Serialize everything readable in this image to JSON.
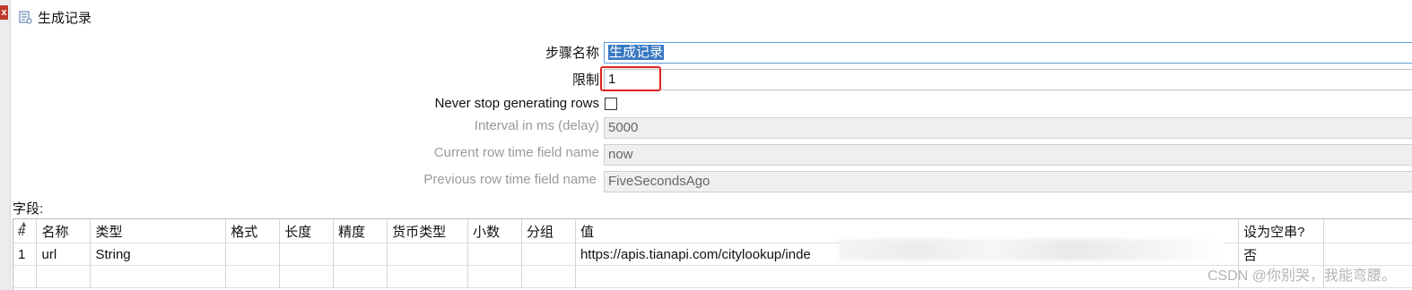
{
  "window": {
    "title": "生成记录",
    "close_glyph": "x"
  },
  "form": {
    "step_name_label": "步骤名称",
    "step_name_value": "生成记录",
    "limit_label": "限制",
    "limit_value": "1",
    "never_stop_label": "Never stop generating rows",
    "never_stop_checked": false,
    "interval_label": "Interval in ms (delay)",
    "interval_value": "5000",
    "current_row_label": "Current row time field name",
    "current_row_value": "now",
    "previous_row_label": "Previous row time field name",
    "previous_row_value": "FiveSecondsAgo"
  },
  "fields": {
    "section_label": "字段:",
    "columns": [
      "#",
      "名称",
      "类型",
      "格式",
      "长度",
      "精度",
      "货币类型",
      "小数",
      "分组",
      "值",
      "设为空串?"
    ],
    "rows": [
      [
        "1",
        "url",
        "String",
        "",
        "",
        "",
        "",
        "",
        "",
        "https://apis.tianapi.com/citylookup/inde",
        "否"
      ]
    ]
  },
  "watermark": "CSDN @你别哭，我能弯腰。",
  "colors": {
    "highlight_border": "#e0221e",
    "selection": "#3a78c3"
  }
}
